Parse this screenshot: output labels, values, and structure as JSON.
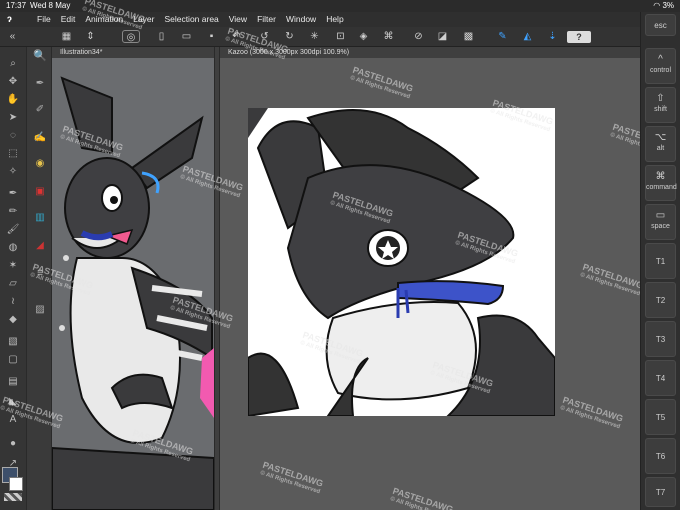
{
  "status": {
    "time": "17:37",
    "date": "Wed 8 May",
    "battery": "3%"
  },
  "menu": [
    "File",
    "Edit",
    "Animation",
    "Layer",
    "Selection area",
    "View",
    "Filter",
    "Window",
    "Help"
  ],
  "cmd": {
    "help": "?"
  },
  "canvas": {
    "left_tab": "Illustration34*",
    "right_tab": "Kazoo (3000 x 3000px 300dpi 100.9%)"
  },
  "watermark": {
    "name": "PASTELDAWG",
    "sub": "© All Rights Reserved"
  },
  "keys": [
    "esc",
    "control",
    "shift",
    "alt",
    "command",
    "space",
    "T1",
    "T2",
    "T3",
    "T4",
    "T5",
    "T6",
    "T7"
  ],
  "colors": {
    "accent": "#3fa2ff",
    "main_color": "#3d4f6a",
    "sub_color": "#ffffff"
  }
}
